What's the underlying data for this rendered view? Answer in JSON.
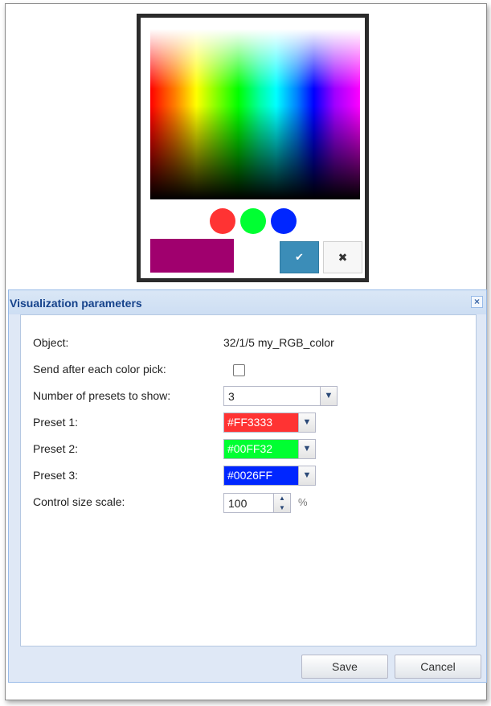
{
  "picker": {
    "presets": [
      {
        "name": "preset-red",
        "color": "#ff3333"
      },
      {
        "name": "preset-green",
        "color": "#00ff32"
      },
      {
        "name": "preset-blue",
        "color": "#0026ff"
      }
    ],
    "current_color": "#a0006e",
    "ok_glyph": "✔",
    "cancel_glyph": "✖"
  },
  "dialog": {
    "title": "Visualization parameters",
    "close_glyph": "×",
    "fields": {
      "object_label": "Object:",
      "object_value": "32/1/5 my_RGB_color",
      "send_label": "Send after each color pick:",
      "send_checked": false,
      "presets_count_label": "Number of presets to show:",
      "presets_count_value": "3",
      "preset1_label": "Preset 1:",
      "preset1_value": "#FF3333",
      "preset1_color": "#ff3333",
      "preset2_label": "Preset 2:",
      "preset2_value": "#00FF32",
      "preset2_color": "#00ff32",
      "preset3_label": "Preset 3:",
      "preset3_value": "#0026FF",
      "preset3_color": "#0026ff",
      "scale_label": "Control size scale:",
      "scale_value": "100",
      "scale_unit": "%"
    },
    "buttons": {
      "save": "Save",
      "cancel": "Cancel"
    }
  }
}
